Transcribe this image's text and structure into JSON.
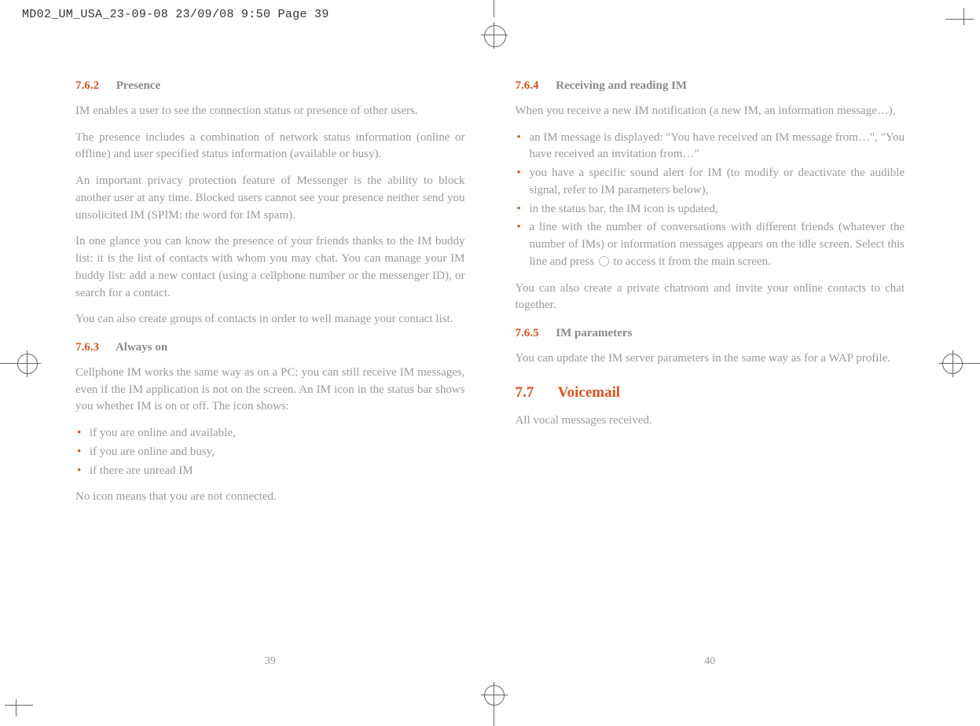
{
  "header_slug": "MD02_UM_USA_23-09-08  23/09/08  9:50  Page 39",
  "left": {
    "s762": {
      "num": "7.6.2",
      "title": "Presence"
    },
    "p1": "IM enables a user to see the connection status or presence of other users.",
    "p2": "The presence includes a combination of network status information (online or offline) and user specified status information (available or busy).",
    "p3": "An important privacy protection feature of Messenger is the ability to block another user at any time. Blocked users cannot see your presence neither send you unsolicited IM (SPIM: the word for IM spam).",
    "p4": "In one glance you can know the presence of your friends thanks to the IM buddy list: it is the list of contacts with whom you may chat. You can manage your IM buddy list: add a new contact (using a cellphone number or the messenger ID), or search for a contact.",
    "p5": "You can also create groups of contacts in order to well manage your contact list.",
    "s763": {
      "num": "7.6.3",
      "title": "Always on"
    },
    "p6": "Cellphone IM works the same way as on a PC: you can still receive IM messages, even if the IM application is not on the screen. An IM icon in the status bar shows you whether IM is on or off. The icon shows:",
    "bullets763": [
      "if you are online and available,",
      "if you are online and busy,",
      "if there are unread IM"
    ],
    "p7": "No icon means that you are not connected.",
    "pagenum": "39"
  },
  "right": {
    "s764": {
      "num": "7.6.4",
      "title": "Receiving and reading IM"
    },
    "p1": "When you receive a new IM notification (a new IM, an information message…),",
    "bullets764": [
      "an IM message is displayed: \"You have received an IM message from…\", \"You have received an invitation from…\"",
      "you have a specific sound alert for IM (to modify or deactivate the audible signal, refer to IM parameters below),",
      "in the status bar, the IM icon is updated,"
    ],
    "bullet764_last_a": "a line with the number of conversations with different friends (whatever the number of IMs) or information messages appears on the idle screen. Select this line and press ",
    "bullet764_last_b": " to access it from the main screen.",
    "p2": "You can also create a private chatroom and invite your online contacts to chat together.",
    "s765": {
      "num": "7.6.5",
      "title": "IM parameters"
    },
    "p3": "You can update the IM server parameters in the same way as for a WAP profile.",
    "s77": {
      "num": "7.7",
      "title": "Voicemail"
    },
    "p4": "All vocal messages received.",
    "pagenum": "40"
  }
}
